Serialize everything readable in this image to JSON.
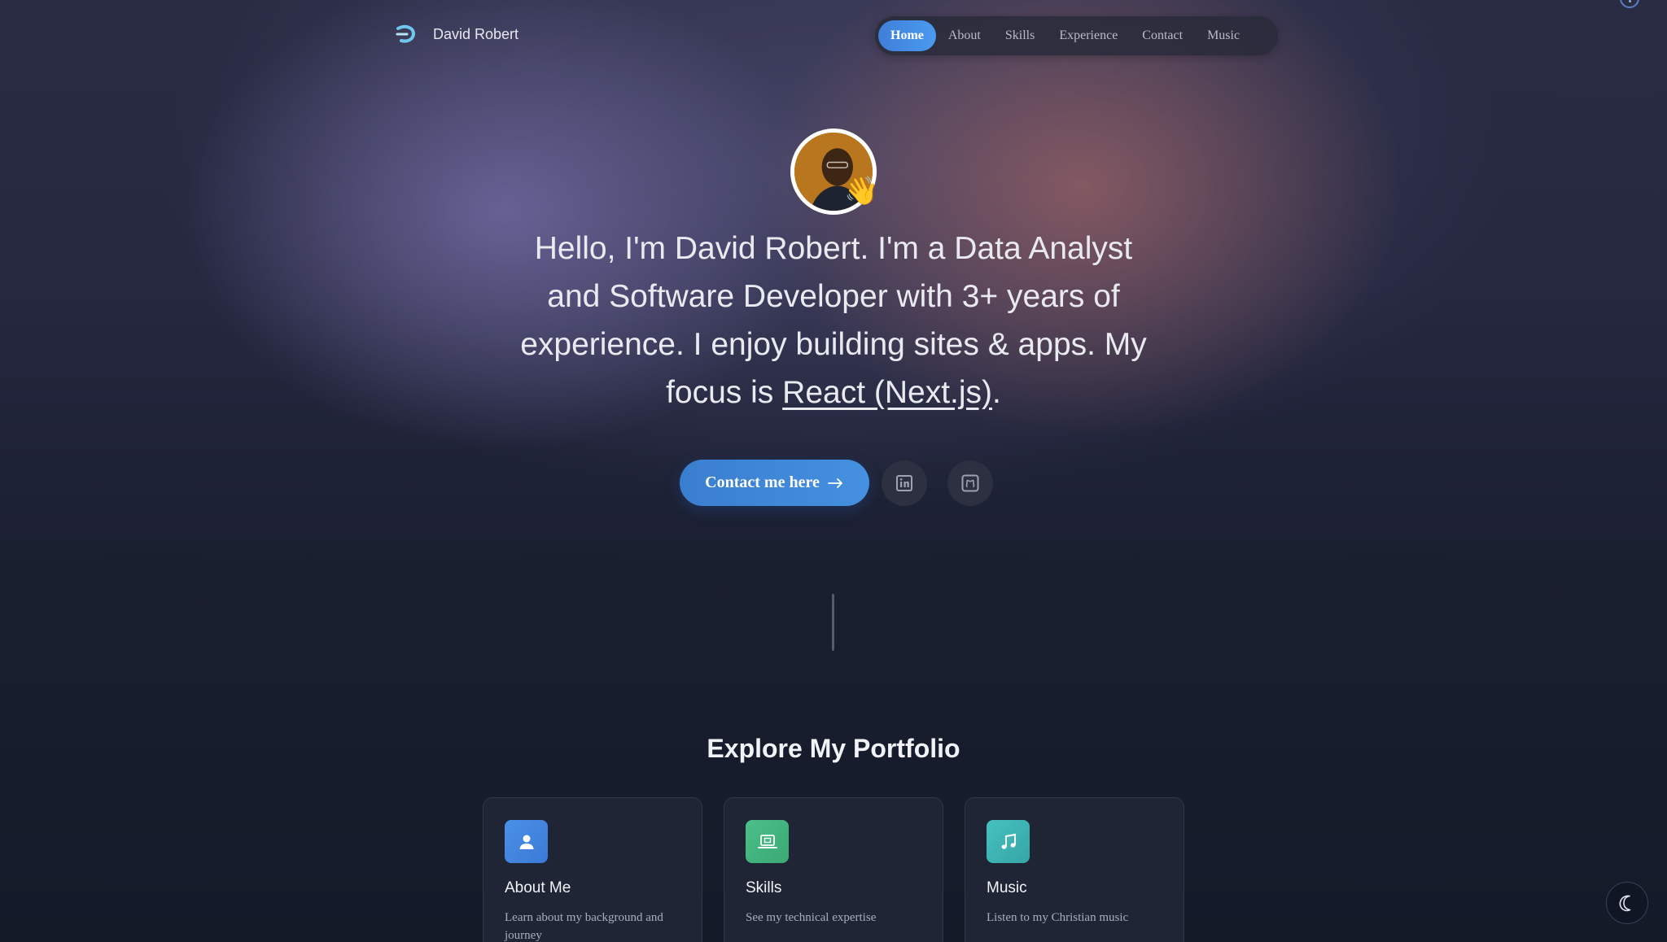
{
  "brand": {
    "name": "David Robert"
  },
  "nav": {
    "items": [
      {
        "label": "Home",
        "active": true
      },
      {
        "label": "About"
      },
      {
        "label": "Skills"
      },
      {
        "label": "Experience"
      },
      {
        "label": "Contact"
      },
      {
        "label": "Music"
      }
    ]
  },
  "hero": {
    "text_before": "Hello, I'm David Robert. I'm a Data Analyst and Software Developer with 3+ years of experience. I enjoy building sites & apps. My focus is ",
    "focus": "React (Next.js)",
    "text_after": ".",
    "wave_emoji": "👋",
    "cta_label": "Contact me here",
    "cta_icon": "arrow-right-icon",
    "social": [
      {
        "icon": "linkedin-icon"
      },
      {
        "icon": "github-icon"
      }
    ]
  },
  "portfolio": {
    "title": "Explore My Portfolio",
    "cards": [
      {
        "title": "About Me",
        "description": "Learn about my background and journey",
        "icon": "user-icon",
        "color": "#4a90e8"
      },
      {
        "title": "Skills",
        "description": "See my technical expertise",
        "icon": "laptop-icon",
        "color": "#4cc08a"
      },
      {
        "title": "Music",
        "description": "Listen to my Christian music",
        "icon": "music-note-icon",
        "color": "#46c2c0"
      }
    ]
  },
  "theme_toggle": {
    "icon": "moon-icon"
  }
}
